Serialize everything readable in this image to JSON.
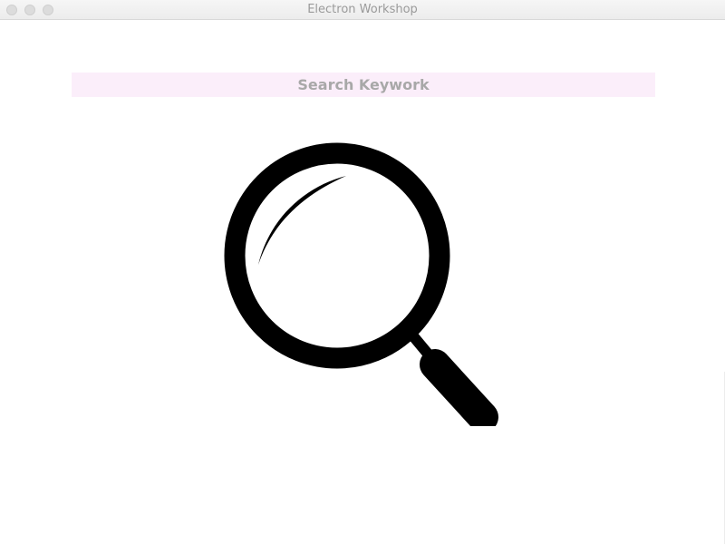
{
  "window": {
    "title": "Electron Workshop"
  },
  "search": {
    "placeholder": "Search Keywork",
    "value": ""
  },
  "colors": {
    "input_background": "#fbeefa",
    "placeholder_text": "#a8a8a8",
    "icon": "#000000"
  },
  "icons": {
    "main": "magnifying-glass-icon"
  }
}
